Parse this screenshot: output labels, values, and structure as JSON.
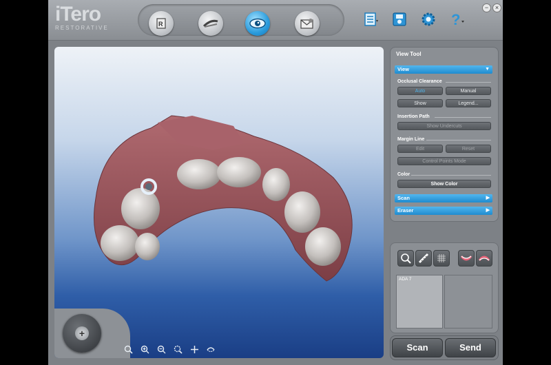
{
  "app": {
    "logo_name": "iTero",
    "logo_sub": "RESTORATIVE"
  },
  "toolbar": {
    "modes": [
      {
        "icon": "rx-form-icon",
        "active": false
      },
      {
        "icon": "scan-wand-icon",
        "active": false
      },
      {
        "icon": "view-eye-icon",
        "active": true
      },
      {
        "icon": "send-envelope-icon",
        "active": false
      }
    ],
    "tools": [
      "notes-list-icon",
      "save-disk-icon",
      "settings-gear-icon",
      "help-question-icon"
    ],
    "window_min": "−",
    "window_close": "×"
  },
  "view_tool": {
    "title": "View Tool",
    "view_bar": "View",
    "occlusal_clearance": {
      "label": "Occlusal Clearance",
      "auto": "Auto",
      "manual": "Manual",
      "show": "Show",
      "legend": "Legend..."
    },
    "insertion_path": {
      "label": "Insertion Path",
      "show_undercuts": "Show Undercuts"
    },
    "margin_line": {
      "label": "Margin Line",
      "edit": "Edit",
      "reset": "Reset",
      "control_points": "Control Points Mode"
    },
    "color": {
      "label": "Color",
      "show_color": "Show Color"
    },
    "scan_bar": "Scan",
    "eraser_bar": "Eraser"
  },
  "bottom_panel": {
    "list_item": "ADA 7"
  },
  "actions": {
    "scan": "Scan",
    "send": "Send"
  },
  "colors": {
    "accent_blue": "#2a9bdc",
    "tooth": "#c9c5c3",
    "gum": "#9e5a5f"
  }
}
